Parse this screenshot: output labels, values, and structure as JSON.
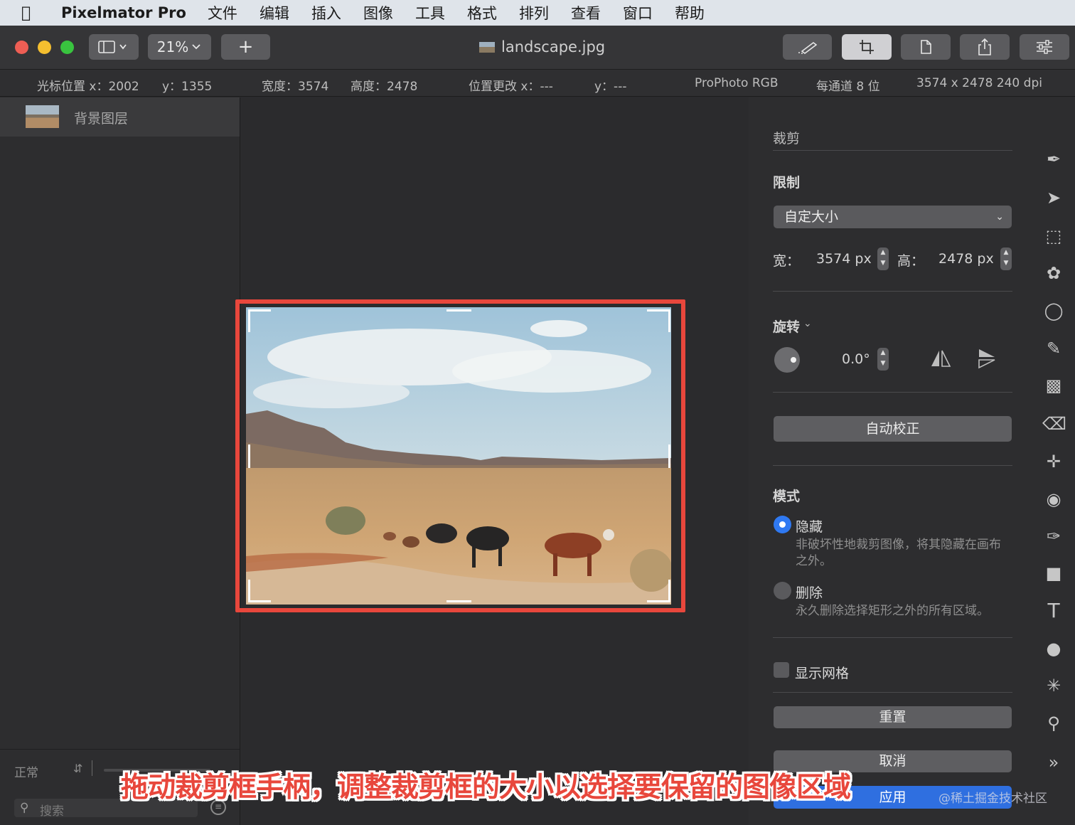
{
  "menubar": {
    "app_name": "Pixelmator Pro",
    "items": [
      "文件",
      "编辑",
      "插入",
      "图像",
      "工具",
      "格式",
      "排列",
      "查看",
      "窗口",
      "帮助"
    ]
  },
  "toolbar": {
    "zoom_label": "21%",
    "add_label": "+",
    "document_title": "landscape.jpg"
  },
  "infobar": {
    "cursor_x": "光标位置 x：2002",
    "cursor_y": "y：1355",
    "width": "宽度：3574",
    "height": "高度：2478",
    "pos_change_x": "位置更改 x：---",
    "pos_change_y": "y：---",
    "color_profile": "ProPhoto RGB",
    "bit_depth": "每通道 8 位",
    "dimensions": "3574 x 2478 240 dpi"
  },
  "layers": {
    "items": [
      {
        "name": "背景图层"
      }
    ],
    "blend_mode": "正常",
    "search_placeholder": "搜索"
  },
  "crop": {
    "title": "裁剪",
    "constraint_title": "限制",
    "constraint_value": "自定大小",
    "width_label": "宽：",
    "width_value": "3574 px",
    "height_label": "高：",
    "height_value": "2478 px",
    "rotate_title": "旋转",
    "rotate_value": "0.0°",
    "auto_straighten": "自动校正",
    "mode_title": "模式",
    "mode_hide": "隐藏",
    "mode_hide_desc": "非破坏性地裁剪图像，将其隐藏在画布之外。",
    "mode_delete": "删除",
    "mode_delete_desc": "永久删除选择矩形之外的所有区域。",
    "show_grid": "显示网格",
    "reset": "重置",
    "cancel": "取消",
    "apply": "应用"
  },
  "overlay": {
    "caption": "拖动裁剪框手柄，调整裁剪框的大小以选择要保留的图像区域",
    "watermark": "@稀土掘金技术社区"
  },
  "colors": {
    "accent_red": "#e8473c",
    "accent_blue": "#2f79f2",
    "traffic_close": "#ee5e54",
    "traffic_min": "#f5bf2f",
    "traffic_max": "#39c43f"
  }
}
